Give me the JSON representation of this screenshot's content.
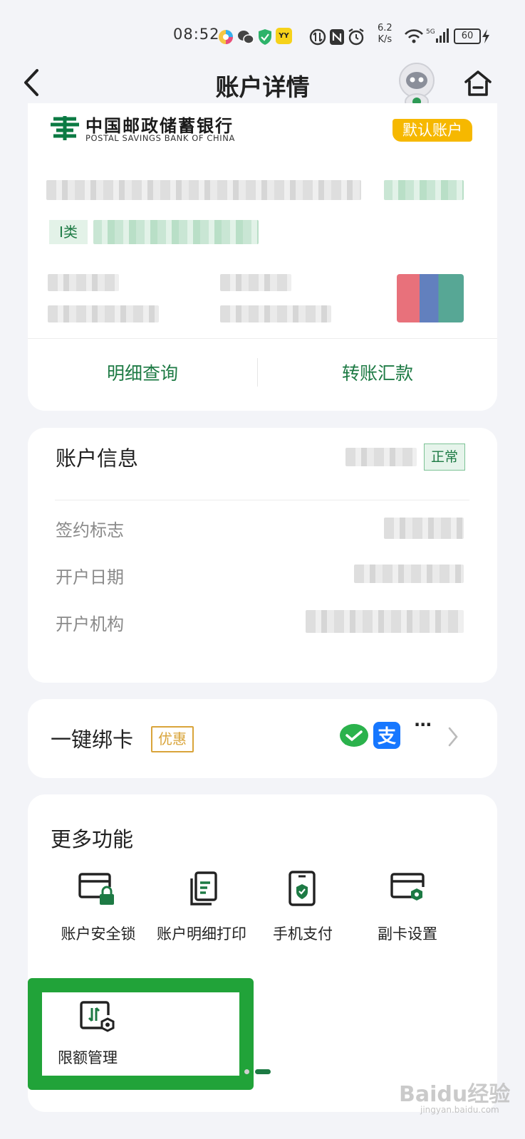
{
  "status_bar": {
    "time": "08:52",
    "net_speed_value": "6.2",
    "net_speed_unit": "K/s",
    "battery": "60",
    "badge_yy": "YY"
  },
  "header": {
    "title": "账户详情",
    "back_icon": "back-arrow-icon",
    "home_icon": "home-icon"
  },
  "account_card": {
    "bank_name_cn": "中国邮政储蓄银行",
    "bank_name_en": "POSTAL SAVINGS BANK OF CHINA",
    "default_badge": "默认账户",
    "class_label": "I类",
    "action_detail": "明细查询",
    "action_transfer": "转账汇款"
  },
  "account_info": {
    "title": "账户信息",
    "status_badge": "正常",
    "rows": [
      {
        "label": "签约标志"
      },
      {
        "label": "开户日期"
      },
      {
        "label": "开户机构"
      }
    ]
  },
  "bind_card": {
    "title": "一键绑卡",
    "promo_badge": "优惠",
    "more": "···"
  },
  "more_functions": {
    "title": "更多功能",
    "items": [
      {
        "label": "账户安全锁",
        "icon": "card-lock-icon"
      },
      {
        "label": "账户明细打印",
        "icon": "document-print-icon"
      },
      {
        "label": "手机支付",
        "icon": "phone-pay-icon"
      },
      {
        "label": "副卡设置",
        "icon": "card-settings-icon"
      },
      {
        "label": "限额管理",
        "icon": "limit-settings-icon"
      }
    ]
  },
  "watermark": {
    "text": "Baidu经验",
    "sub": "jingyan.baidu.com"
  },
  "colors": {
    "accent_green": "#1d7a44",
    "highlight_green": "#21a339",
    "badge_yellow": "#f6b800",
    "promo_gold": "#d9a43a"
  }
}
